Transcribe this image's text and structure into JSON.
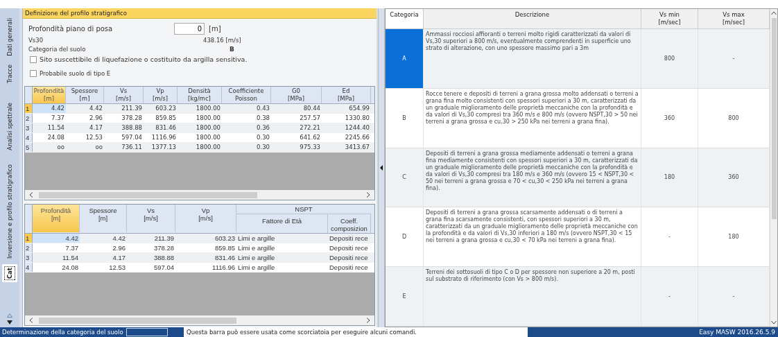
{
  "side_tabs": [
    {
      "label": "Dati generali",
      "selected": false
    },
    {
      "label": "Tracce",
      "selected": false
    },
    {
      "label": "Analisi spettrale",
      "selected": false
    },
    {
      "label": "Inversione e profilo stratigrafico",
      "selected": false
    },
    {
      "label": "Cat",
      "selected": true
    }
  ],
  "section_title": "Definizione del profilo stratigrafico",
  "form": {
    "depth_label": "Profondità piano di posa",
    "depth_value": "0",
    "depth_unit": "[m]",
    "vs30_label": "Vs30",
    "vs30_value": "438.16 [m/s]",
    "category_label": "Categoria del suolo",
    "category_value": "B",
    "checkboxes": [
      {
        "label": "Sito suscettibile di liquefazione o costituito da argilla sensitiva.",
        "checked": false
      },
      {
        "label": "Probabile suolo di tipo E",
        "checked": false
      }
    ]
  },
  "layers_table": {
    "columns": [
      {
        "name": "Profondità",
        "unit": "[m]",
        "selected": true
      },
      {
        "name": "Spessore",
        "unit": "[m]",
        "selected": false
      },
      {
        "name": "Vs",
        "unit": "[m/s]",
        "selected": false
      },
      {
        "name": "Vp",
        "unit": "[m/s]",
        "selected": false
      },
      {
        "name": "Densità",
        "unit": "[kg/mc]",
        "selected": false
      },
      {
        "name": "Coefficiente",
        "unit": "Poisson",
        "selected": false
      },
      {
        "name": "G0",
        "unit": "[MPa]",
        "selected": false
      },
      {
        "name": "Ed",
        "unit": "[MPa]",
        "selected": false
      }
    ],
    "rows": [
      {
        "index": "1",
        "selected": true,
        "cells": [
          "4.42",
          "4.42",
          "211.39",
          "603.23",
          "1800.00",
          "0.43",
          "80.44",
          "654.99"
        ]
      },
      {
        "index": "2",
        "selected": false,
        "cells": [
          "7.37",
          "2.96",
          "378.28",
          "859.85",
          "1800.00",
          "0.38",
          "257.57",
          "1330.80"
        ]
      },
      {
        "index": "3",
        "selected": false,
        "cells": [
          "11.54",
          "4.17",
          "388.88",
          "831.46",
          "1800.00",
          "0.36",
          "272.21",
          "1244.40"
        ]
      },
      {
        "index": "4",
        "selected": false,
        "cells": [
          "24.08",
          "12.53",
          "597.04",
          "1116.96",
          "1800.00",
          "0.30",
          "641.62",
          "2245.66"
        ]
      },
      {
        "index": "5",
        "selected": false,
        "cells": [
          "oo",
          "oo",
          "736.11",
          "1377.13",
          "1800.00",
          "0.30",
          "975.33",
          "3413.67"
        ]
      }
    ]
  },
  "nspt_table": {
    "group_label": "NSPT",
    "columns": [
      {
        "name": "Profondità",
        "unit": "[m]",
        "selected": true
      },
      {
        "name": "Spessore",
        "unit": "[m]",
        "selected": false
      },
      {
        "name": "Vs",
        "unit": "[m/s]",
        "selected": false
      },
      {
        "name": "Vp",
        "unit": "[m/s]",
        "selected": false
      },
      {
        "name": "Fattore di Età",
        "selected": false
      },
      {
        "name": "Coeff. composizion",
        "selected": false
      }
    ],
    "rows": [
      {
        "index": "1",
        "selected": true,
        "cells": [
          "4.42",
          "4.42",
          "211.39",
          "603.23",
          "Limi e argille",
          "Depositi rece"
        ]
      },
      {
        "index": "2",
        "selected": false,
        "cells": [
          "7.37",
          "2.96",
          "378.28",
          "859.85",
          "Limi e argille",
          "Depositi rece"
        ]
      },
      {
        "index": "3",
        "selected": false,
        "cells": [
          "11.54",
          "4.17",
          "388.88",
          "831.46",
          "Limi e argille",
          "Depositi rece"
        ]
      },
      {
        "index": "4",
        "selected": false,
        "cells": [
          "24.08",
          "12.53",
          "597.04",
          "1116.96",
          "Limi e argille",
          "Depositi rece"
        ]
      }
    ]
  },
  "categories_table": {
    "columns": [
      "Categoria",
      "Descrizione",
      "Vs min\n[m/sec]",
      "Vs max\n[m/sec]"
    ],
    "rows": [
      {
        "category": "A",
        "selected": true,
        "description": "Ammassi rocciosi affioranti o terreni molto rigidi caratterizzati da valori di Vs,30 superiori a 800 m/s, eventualmente comprendenti in superficie uno strato di alterazione, con uno spessore massimo pari a 3m",
        "vs_min": "800",
        "vs_max": "-"
      },
      {
        "category": "B",
        "selected": false,
        "description": "Rocce tenere e depositi di terreni a grana grossa molto addensati o terreni a grana fina molto consistenti con spessori superiori a 30 m, caratterizzati da un graduale miglioramento delle proprietà meccaniche con la profondità e da valori di Vs,30 compresi tra 360 m/s e 800 m/s (ovvero NSPT,30 > 50 nei terreni a grana grossa e cu,30 > 250 kPa nei terreni a grana fina).",
        "vs_min": "360",
        "vs_max": "800"
      },
      {
        "category": "C",
        "selected": false,
        "description": "Depositi di terreni a grana grossa mediamente addensati o terreni a grana fina mediamente consistenti con spessori superiori a 30 m, caratterizzati da un graduale miglioramento delle proprietà meccaniche con la profondità e da valori di Vs,30 compresi tra 180 m/s e 360 m/s (ovvero 15 < NSPT,30 < 50 nei terreni a grana grossa e 70 < cu,30 < 250 kPa nei terreni a grana fina).",
        "vs_min": "180",
        "vs_max": "360"
      },
      {
        "category": "D",
        "selected": false,
        "description": "Depositi di terreni a grana grossa scarsamente addensati o di terreni a grana fina scarsamente consistenti, con spessori superiori a 30 m, caratterizzati da un graduale miglioramento delle proprietà meccaniche con la profondità e da valori di Vs,30 inferiori a 180 m/s (ovvero NSPT,30 < 15 nei terreni a grana grossa e cu,30 < 70 kPa nei terreni a grana fina).",
        "vs_min": "-",
        "vs_max": "180"
      },
      {
        "category": "E",
        "selected": false,
        "description": "Terreni dei sottosuoli di tipo C o D per spessore non superiore a 20 m, posti sul substrato di riferimento (con Vs > 800 m/s).",
        "vs_min": "-",
        "vs_max": "-"
      }
    ]
  },
  "status_bar": {
    "label": "Determinazione della categoria del suolo",
    "message": "Questa barra può essere usata come scorciatoia per eseguire alcuni comandi.",
    "version": "Easy MASW 2016.26.5.9"
  }
}
